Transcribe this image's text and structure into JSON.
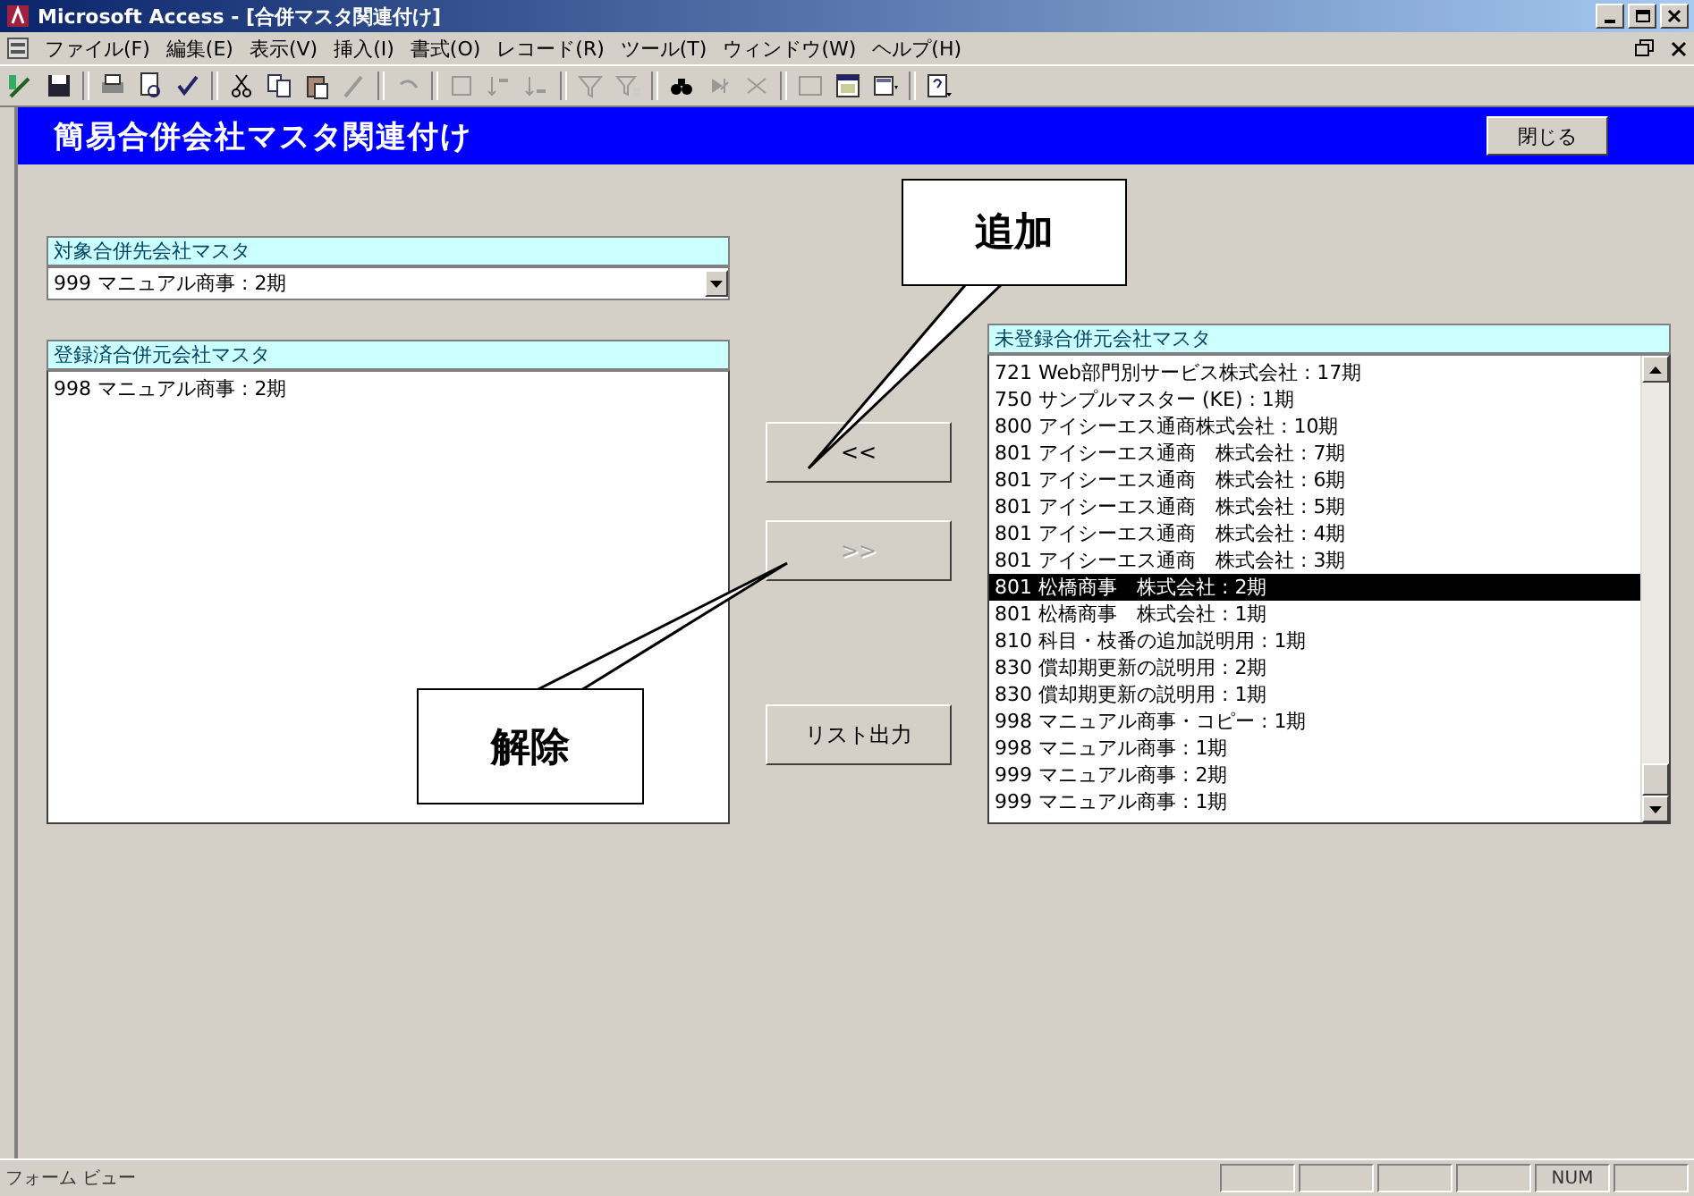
{
  "window": {
    "title": "Microsoft Access - [合併マスタ関連付け]"
  },
  "menu": [
    "ファイル(F)",
    "編集(E)",
    "表示(V)",
    "挿入(I)",
    "書式(O)",
    "レコード(R)",
    "ツール(T)",
    "ウィンドウ(W)",
    "ヘルプ(H)"
  ],
  "form": {
    "title": "簡易合併会社マスタ関連付け",
    "close_button": "閉じる"
  },
  "target_master": {
    "label": "対象合併先会社マスタ",
    "value": "999 マニュアル商事 : 2期"
  },
  "registered": {
    "label": "登録済合併元会社マスタ",
    "items": [
      {
        "text": "998 マニュアル商事 : 2期",
        "selected": false
      }
    ]
  },
  "unregistered": {
    "label": "未登録合併元会社マスタ",
    "items": [
      {
        "text": "721 Web部門別サービス株式会社 : 17期",
        "selected": false
      },
      {
        "text": "750 サンプルマスター (KE) : 1期",
        "selected": false
      },
      {
        "text": "800 アイシーエス通商株式会社 : 10期",
        "selected": false
      },
      {
        "text": "801 アイシーエス通商　株式会社 : 7期",
        "selected": false
      },
      {
        "text": "801 アイシーエス通商　株式会社 : 6期",
        "selected": false
      },
      {
        "text": "801 アイシーエス通商　株式会社 : 5期",
        "selected": false
      },
      {
        "text": "801 アイシーエス通商　株式会社 : 4期",
        "selected": false
      },
      {
        "text": "801 アイシーエス通商　株式会社 : 3期",
        "selected": false
      },
      {
        "text": "801 松橋商事　株式会社 : 2期",
        "selected": true
      },
      {
        "text": "801 松橋商事　株式会社 : 1期",
        "selected": false
      },
      {
        "text": "810 科目・枝番の追加説明用 : 1期",
        "selected": false
      },
      {
        "text": "830 償却期更新の説明用 : 2期",
        "selected": false
      },
      {
        "text": "830 償却期更新の説明用 : 1期",
        "selected": false
      },
      {
        "text": "998 マニュアル商事・コピー : 1期",
        "selected": false
      },
      {
        "text": "998 マニュアル商事 : 1期",
        "selected": false
      },
      {
        "text": "999 マニュアル商事 : 2期",
        "selected": false
      },
      {
        "text": "999 マニュアル商事 : 1期",
        "selected": false
      }
    ]
  },
  "buttons": [
    {
      "label": "<<",
      "disabled": false
    },
    {
      "label": ">>",
      "disabled": true
    },
    {
      "label": "リスト出力",
      "disabled": false
    }
  ],
  "callouts": [
    {
      "text": "追加"
    },
    {
      "text": "解除"
    }
  ],
  "status_bar": {
    "mode": "フォーム ビュー",
    "indicators": [
      "NUM"
    ]
  }
}
